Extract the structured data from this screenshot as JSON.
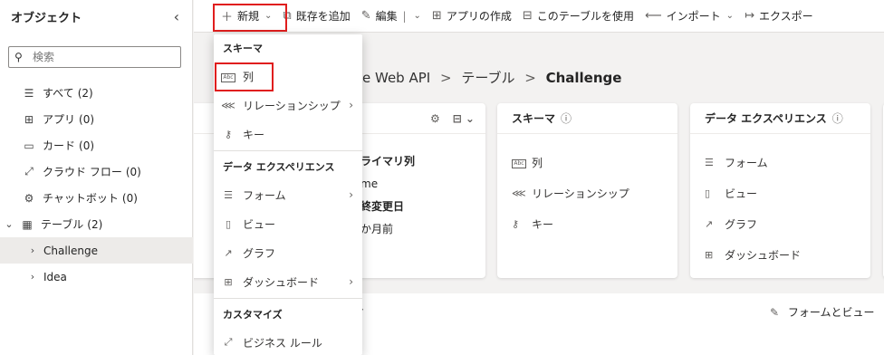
{
  "sidebar": {
    "title": "オブジェクト",
    "search_placeholder": "検索",
    "items": [
      {
        "label": "すべて",
        "count": "(2)"
      },
      {
        "label": "アプリ",
        "count": "(0)"
      },
      {
        "label": "カード",
        "count": "(0)"
      },
      {
        "label": "クラウド フロー",
        "count": "(0)"
      },
      {
        "label": "チャットボット",
        "count": "(0)"
      },
      {
        "label": "テーブル",
        "count": "(2)"
      },
      {
        "label": "Challenge"
      },
      {
        "label": "Idea"
      }
    ]
  },
  "toolbar": {
    "new_label": "新規",
    "add_existing_label": "既存を追加",
    "edit_label": "編集",
    "create_app_label": "アプリの作成",
    "use_table_label": "このテーブルを使用",
    "import_label": "インポート",
    "export_label": "エクスポー"
  },
  "breadcrumb": {
    "part1": "e Web API",
    "sep": ">",
    "part2": "テーブル",
    "current": "Challenge"
  },
  "cards": {
    "properties": {
      "primary_col_label": "ライマリ列",
      "primary_col_value": "me",
      "modified_label": "終変更日",
      "modified_value": "か月前"
    },
    "schema": {
      "title": "スキーマ",
      "items": [
        "列",
        "リレーションシップ",
        "キー"
      ]
    },
    "data_experience": {
      "title": "データ エクスペリエンス",
      "items": [
        "フォーム",
        "ビュー",
        "グラフ",
        "ダッシュボード"
      ]
    }
  },
  "bottom": {
    "title": "タ",
    "right_label": "フォームとビュー"
  },
  "dropdown": {
    "schema_header": "スキーマ",
    "column": "列",
    "relationship": "リレーションシップ",
    "key": "キー",
    "data_exp_header": "データ エクスペリエンス",
    "form": "フォーム",
    "view": "ビュー",
    "chart": "グラフ",
    "dashboard": "ダッシュボード",
    "customize_header": "カスタマイズ",
    "business_rule": "ビジネス ルール"
  },
  "colors": {
    "highlight_border": "#e01e1e",
    "selected_bg": "#edebe9"
  }
}
